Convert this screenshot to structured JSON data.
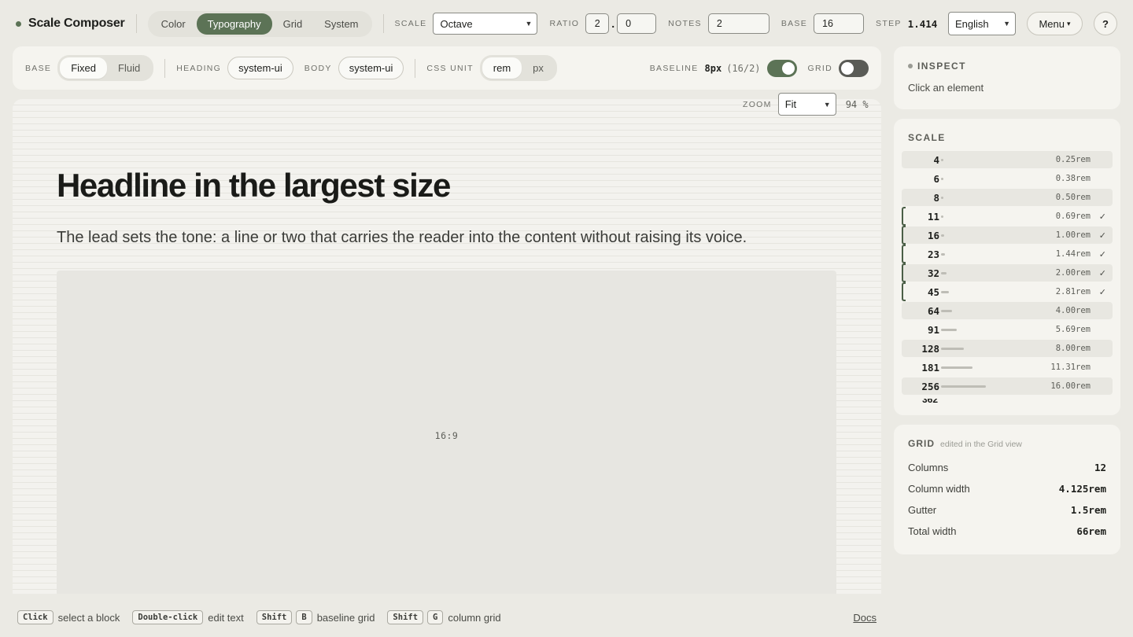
{
  "app": {
    "title": "Scale Composer"
  },
  "nav": {
    "tabs": [
      "Color",
      "Typography",
      "Grid",
      "System"
    ],
    "active": "Typography"
  },
  "controls": {
    "scale_label": "SCALE",
    "scale_value": "Octave",
    "ratio_label": "RATIO",
    "ratio_int": "2",
    "ratio_sep": ".",
    "ratio_frac": "0",
    "notes_label": "NOTES",
    "notes_value": "2",
    "base_label": "BASE",
    "base_value": "16",
    "step_label": "STEP",
    "step_value": "1.414",
    "language": "English",
    "menu": "Menu",
    "menu_caret": "▾",
    "help": "?"
  },
  "toolbar": {
    "base_label": "BASE",
    "base_options": [
      "Fixed",
      "Fluid"
    ],
    "base_active": "Fixed",
    "heading_label": "HEADING",
    "heading_font": "system-ui",
    "body_label": "BODY",
    "body_font": "system-ui",
    "unit_label": "CSS UNIT",
    "unit_options": [
      "rem",
      "px"
    ],
    "unit_active": "rem",
    "baseline_label": "BASELINE",
    "baseline_value": "8px",
    "baseline_detail": "(16/2)",
    "baseline_on": true,
    "grid_label": "GRID",
    "grid_on": false
  },
  "canvas": {
    "zoom_label": "ZOOM",
    "zoom_value": "Fit",
    "zoom_percent": "94 %",
    "headline": "Headline in the largest size",
    "lead": "The lead sets the tone: a line or two that carries the reader into the content without raising its voice.",
    "media_ratio": "16:9"
  },
  "inspect": {
    "title": "INSPECT",
    "hint": "Click an element"
  },
  "scale": {
    "title": "SCALE",
    "steps": [
      {
        "px": "4",
        "rem": "0.25rem",
        "used": false
      },
      {
        "px": "6",
        "rem": "0.38rem",
        "used": false
      },
      {
        "px": "8",
        "rem": "0.50rem",
        "used": false
      },
      {
        "px": "11",
        "rem": "0.69rem",
        "used": true
      },
      {
        "px": "16",
        "rem": "1.00rem",
        "used": true
      },
      {
        "px": "23",
        "rem": "1.44rem",
        "used": true
      },
      {
        "px": "32",
        "rem": "2.00rem",
        "used": true
      },
      {
        "px": "45",
        "rem": "2.81rem",
        "used": true
      },
      {
        "px": "64",
        "rem": "4.00rem",
        "used": false
      },
      {
        "px": "91",
        "rem": "5.69rem",
        "used": false
      },
      {
        "px": "128",
        "rem": "8.00rem",
        "used": false
      },
      {
        "px": "181",
        "rem": "11.31rem",
        "used": false
      },
      {
        "px": "256",
        "rem": "16.00rem",
        "used": false
      }
    ],
    "check_mark": "✓"
  },
  "grid": {
    "title": "GRID",
    "note": "edited in the Grid view",
    "rows": [
      {
        "label": "Columns",
        "value": "12"
      },
      {
        "label": "Column width",
        "value": "4.125rem"
      },
      {
        "label": "Gutter",
        "value": "1.5rem"
      },
      {
        "label": "Total width",
        "value": "66rem"
      }
    ]
  },
  "footer": {
    "hints": [
      {
        "keys": [
          "Click"
        ],
        "text": "select a block"
      },
      {
        "keys": [
          "Double-click"
        ],
        "text": "edit text"
      },
      {
        "keys": [
          "Shift",
          "B"
        ],
        "text": "baseline grid"
      },
      {
        "keys": [
          "Shift",
          "G"
        ],
        "text": "column grid"
      }
    ],
    "docs": "Docs"
  },
  "colors": {
    "accent": "#5c7356",
    "background": "#ebeae4",
    "card": "#f5f4ef"
  }
}
